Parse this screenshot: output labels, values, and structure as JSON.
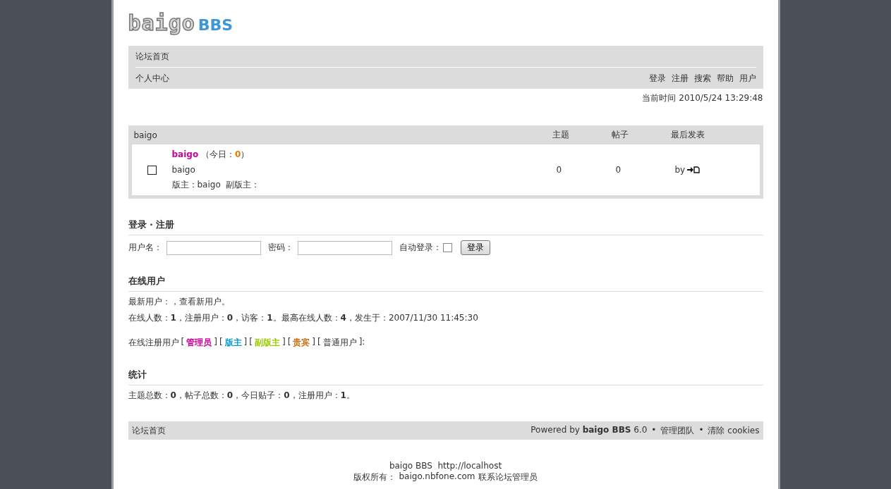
{
  "logo": {
    "brand": "baigo",
    "product": "BBS"
  },
  "nav": {
    "home": "论坛首页",
    "user_center": "个人中心",
    "links": [
      "登录",
      "注册",
      "搜索",
      "帮助",
      "用户"
    ]
  },
  "current_time": "当前时间 2010/5/24 13:29:48",
  "forum_table": {
    "category": "baigo",
    "columns": [
      "主题",
      "帖子",
      "最后发表"
    ],
    "rows": [
      {
        "name": "baigo",
        "today": "（今日：**0**）",
        "description": "baigo",
        "moderators": "版主：baigo  副版主：",
        "topics": "0",
        "posts": "0",
        "last_post": "by"
      }
    ]
  },
  "login": {
    "title": "登录 · 注册",
    "username_label": "用户名：",
    "password_label": "密码：",
    "auto_label": "自动登录：",
    "auto_checked": false,
    "button": "登录"
  },
  "online": {
    "title": "在线用户",
    "newest": "最新用户：，查看新用户。",
    "counts": "在线人数：**1**，注册用户：**0**，访客：**1**。最高在线人数：**4**，发生于：2007/11/30 11:45:30",
    "groups_label": "在线注册用户",
    "groups": [
      {
        "open": "[",
        "label": "管理员",
        "close": "]",
        "kind": "role",
        "color": "#cc0099"
      },
      {
        "open": "[",
        "label": "版主",
        "close": "]",
        "kind": "role",
        "color": "#0099cc"
      },
      {
        "open": "[",
        "label": "副版主",
        "close": "]",
        "kind": "role",
        "color": "#99cc00"
      },
      {
        "open": "[",
        "label": "贵宾",
        "close": "]",
        "kind": "role",
        "color": "#cc6600"
      },
      {
        "open": "[",
        "label": "普通用户",
        "close": "]:",
        "kind": "plain"
      }
    ]
  },
  "stats": {
    "title": "统计",
    "text": "主题总数：**0**，帖子总数：**0**，今日贴子：**0**，注册用户：**1**。"
  },
  "footer_bar": {
    "home": "论坛首页",
    "powered": "Powered by **baigo BBS** 6.0",
    "separator_1": "•",
    "team": "管理团队",
    "separator_2": "•",
    "clear": "清除 cookies"
  },
  "bottom": {
    "site": "baigo BBS  http://localhost",
    "copyright": "版权所有：",
    "domain": "baigo.nbfone.com",
    "contact": "联系论坛管理员"
  }
}
